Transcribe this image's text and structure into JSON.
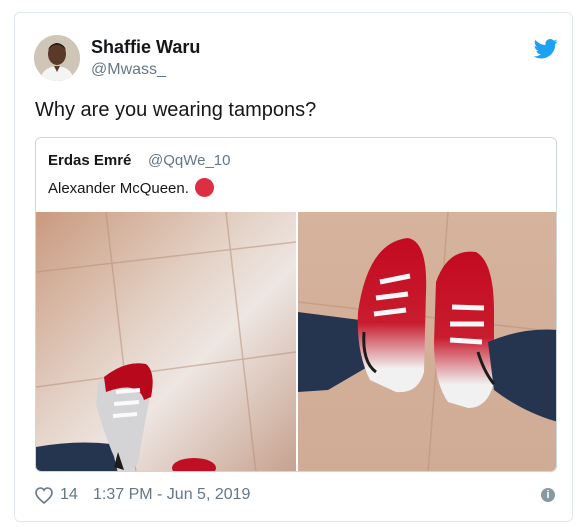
{
  "tweet": {
    "author": {
      "name": "Shaffie Waru",
      "handle": "@Mwass_"
    },
    "text": "Why are you wearing tampons?",
    "quoted": {
      "name": "Erdas Emré",
      "handle": "@QqWe_10",
      "text": "Alexander McQueen.",
      "emoji": "red-circle-icon"
    },
    "likes": "14",
    "timestamp": "1:37 PM - Jun 5, 2019"
  },
  "colors": {
    "twitter_blue": "#1da1f2",
    "text_secondary": "#657786",
    "border": "#e1e8ed",
    "red_sole": "#c8102e"
  },
  "icons": {
    "brand": "twitter-bird-icon",
    "like": "heart-icon",
    "info": "info-icon"
  }
}
